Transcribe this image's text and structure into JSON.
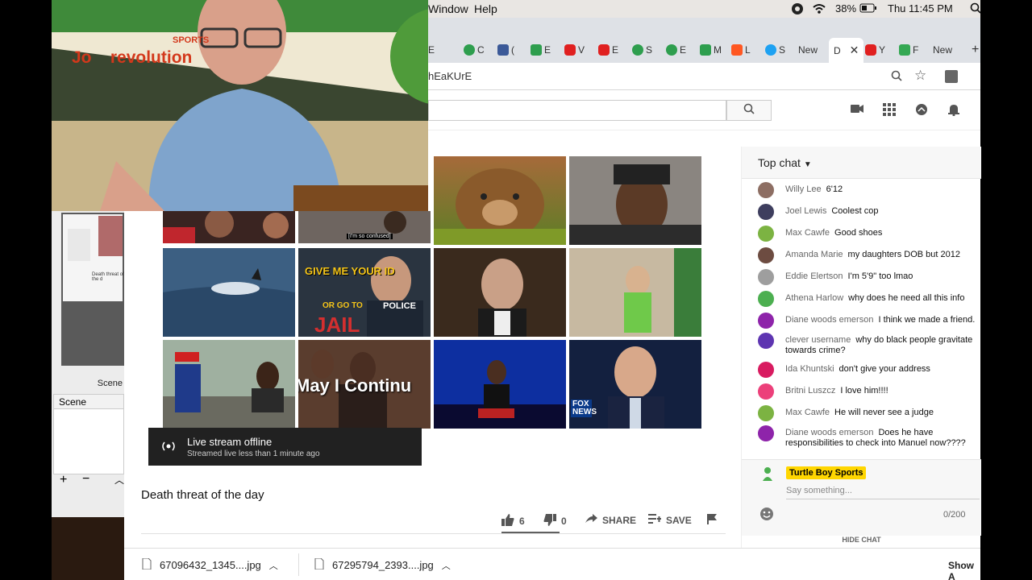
{
  "menubar": {
    "window_label": "Window",
    "help_label": "Help",
    "battery_pct": "38%",
    "clock": "Thu 11:45 PM"
  },
  "tabs": [
    {
      "label": "E",
      "color": "#2e9e4e"
    },
    {
      "label": "C",
      "color": "#2e9e4e"
    },
    {
      "label": "(",
      "color": "#3b5998"
    },
    {
      "label": "E",
      "color": "#2e9e4e"
    },
    {
      "label": "V",
      "color": "#e02020"
    },
    {
      "label": "E",
      "color": "#e02020"
    },
    {
      "label": "S",
      "color": "#2e9e4e"
    },
    {
      "label": "E",
      "color": "#2e9e4e"
    },
    {
      "label": "M",
      "color": "#2e9e4e"
    },
    {
      "label": "L",
      "color": "#ff5722"
    },
    {
      "label": "S",
      "color": "#1da1f2"
    },
    {
      "label": "New",
      "color": ""
    },
    {
      "label": "D",
      "color": ""
    },
    {
      "label": "Y",
      "color": "#e02020"
    },
    {
      "label": "F",
      "color": "#34a853"
    },
    {
      "label": "New",
      "color": ""
    }
  ],
  "address": {
    "url": "hEaKUrE"
  },
  "video": {
    "thumb_texts": {
      "confused": "[I'm so confused]",
      "give_me": "GIVE ME YOUR ID",
      "or_go": "OR GO TO",
      "jail": "JAIL",
      "police": "POLICE",
      "may_i": "May I Continu",
      "fox": "FOX NEWS"
    },
    "offline_title": "Live stream offline",
    "offline_sub": "Streamed live less than 1 minute ago",
    "title": "Death threat of the day"
  },
  "actions": {
    "likes": "6",
    "dislikes": "0",
    "share": "SHARE",
    "save": "SAVE"
  },
  "chat": {
    "header": "Top chat",
    "messages": [
      {
        "author": "Willy Lee",
        "text": "6'12",
        "color": "#8d6e63"
      },
      {
        "author": "Joel Lewis",
        "text": "Coolest cop",
        "color": "#3e3e5e"
      },
      {
        "author": "Max Cawfe",
        "text": "Good shoes",
        "color": "#7cb342"
      },
      {
        "author": "Amanda Marie",
        "text": "my daughters DOB but 2012",
        "color": "#6d4c41"
      },
      {
        "author": "Eddie Elertson",
        "text": "I'm 5'9\" too lmao",
        "color": "#9e9e9e"
      },
      {
        "author": "Athena Harlow",
        "text": "why does he need all this info",
        "color": "#4caf50"
      },
      {
        "author": "Diane woods emerson",
        "text": "I think we made a friend.",
        "color": "#8e24aa"
      },
      {
        "author": "clever username",
        "text": "why do black people gravitate towards crime?",
        "color": "#5e35b1"
      },
      {
        "author": "Ida Khuntski",
        "text": "don't give your address",
        "color": "#d81b60"
      },
      {
        "author": "Britni Luszcz",
        "text": "I love him!!!!",
        "color": "#ec407a"
      },
      {
        "author": "Max Cawfe",
        "text": "He will never see a judge",
        "color": "#7cb342"
      },
      {
        "author": "Diane woods emerson",
        "text": "Does he have responsibilities to check into Manuel now????",
        "color": "#8e24aa"
      }
    ],
    "self_name": "Turtle Boy Sports",
    "placeholder": "Say something...",
    "counter": "0/200",
    "hide": "HIDE CHAT"
  },
  "downloads": [
    {
      "name": "67096432_1345....jpg"
    },
    {
      "name": "67295794_2393....jpg"
    }
  ],
  "show_all": "Show A",
  "obs": {
    "scenes_tab": "Scene",
    "scene_header": "Scene",
    "thumb_caption": "Death threat of the d"
  },
  "webcam": {
    "banner_text": "Jo    revolution",
    "banner_sub": "SPORTS"
  }
}
